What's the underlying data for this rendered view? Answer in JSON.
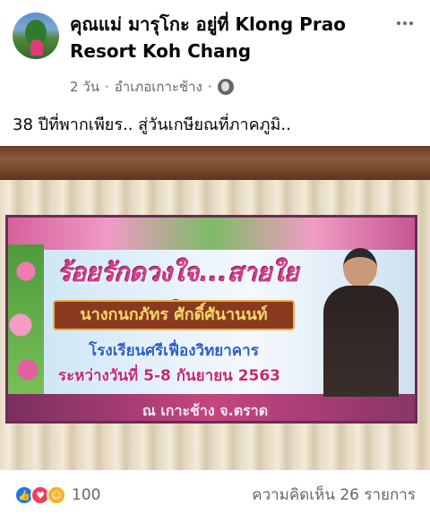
{
  "post": {
    "page_name": "คุณแม่ มารุโกะ อยู่ที่ Klong Prao Resort Koh Chang",
    "time": "2 วัน",
    "separator": "·",
    "location": "อำเภอเกาะช้าง",
    "privacy_icon": "globe-icon",
    "text": "38 ปีที่พากเพียร.. สู่วันเกษียณที่ภาคภูมิ.."
  },
  "banner": {
    "title": "ร้อยรักดวงใจ...สายใยมุทิตา",
    "name": "นางกนกภัทร ศักดิ์ศันานนท์",
    "school": "โรงเรียนศรีเฟื่องวิทยาคาร",
    "date": "ระหว่างวันที่ 5-8 กันยายน 2563",
    "place": "ณ เกาะช้าง จ.ตราด"
  },
  "footer": {
    "reaction_icons": [
      "like-icon",
      "love-icon",
      "care-icon"
    ],
    "reaction_count": "100",
    "comments": "ความคิดเห็น 26 รายการ"
  },
  "colors": {
    "like": "#1877f2",
    "love": "#f33e58",
    "care": "#f7b125",
    "meta_text": "#65676b"
  }
}
